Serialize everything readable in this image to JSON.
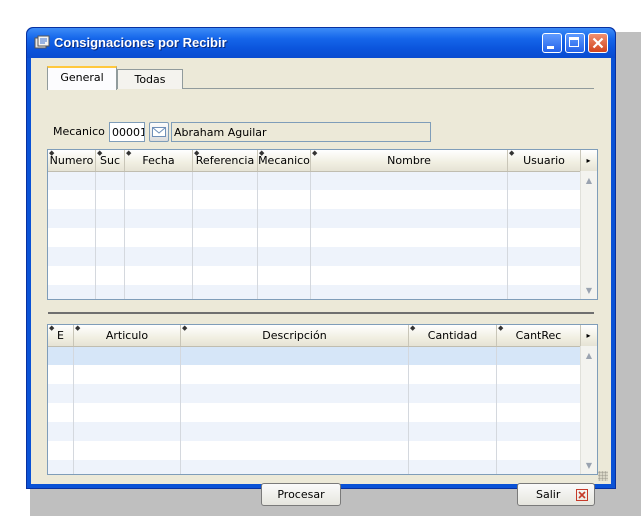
{
  "window": {
    "title": "Consignaciones por Recibir"
  },
  "tabs": [
    {
      "label": "General"
    },
    {
      "label": "Todas"
    }
  ],
  "mechanic": {
    "label": "Mecanico",
    "code": "00001",
    "name": "Abraham Aguilar"
  },
  "upper_grid": {
    "columns": [
      "Numero",
      "Suc",
      "Fecha",
      "Referencia",
      "Mecanico",
      "Nombre",
      "Usuario"
    ]
  },
  "lower_grid": {
    "columns": [
      "E",
      "Articulo",
      "Descripción",
      "Cantidad",
      "CantRec"
    ]
  },
  "buttons": {
    "process": "Procesar",
    "exit": "Salir"
  },
  "colors": {
    "titlebar": "#0a52d6",
    "client": "#ece9d8",
    "tab_highlight": "#ffc83c",
    "row_alt": "#eef3fb"
  }
}
